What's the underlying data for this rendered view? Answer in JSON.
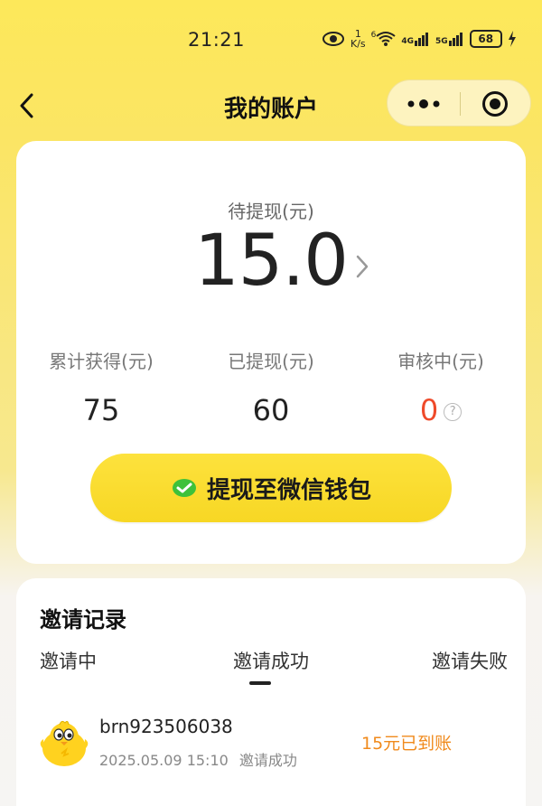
{
  "status_bar": {
    "time": "21:21",
    "net_speed_top": "1",
    "net_speed_unit": "K/s",
    "wifi_badge": "6",
    "sim1": "4G",
    "sim2": "5G",
    "battery": "68"
  },
  "nav": {
    "title": "我的账户"
  },
  "account": {
    "pending_label": "待提现(元)",
    "pending_amount": "15.0",
    "stats": [
      {
        "label": "累计获得(元)",
        "value": "75"
      },
      {
        "label": "已提现(元)",
        "value": "60"
      },
      {
        "label": "审核中(元)",
        "value": "0"
      }
    ],
    "help_icon_text": "?",
    "withdraw_button": "提现至微信钱包"
  },
  "invites": {
    "title": "邀请记录",
    "tabs": [
      "邀请中",
      "邀请成功",
      "邀请失败"
    ],
    "active_tab": "邀请成功",
    "records": [
      {
        "username": "brn923506038",
        "time": "2025.05.09 15:10",
        "status": "邀请成功",
        "reward": "15元已到账"
      }
    ]
  },
  "colors": {
    "accent_yellow": "#fbe123",
    "alert_red": "#ef4a2a",
    "reward_orange": "#f08a1c"
  },
  "icons": [
    "back-arrow-icon",
    "more-dots-icon",
    "record-icon",
    "chevron-right-icon",
    "question-icon",
    "wechat-icon",
    "chick-avatar"
  ]
}
